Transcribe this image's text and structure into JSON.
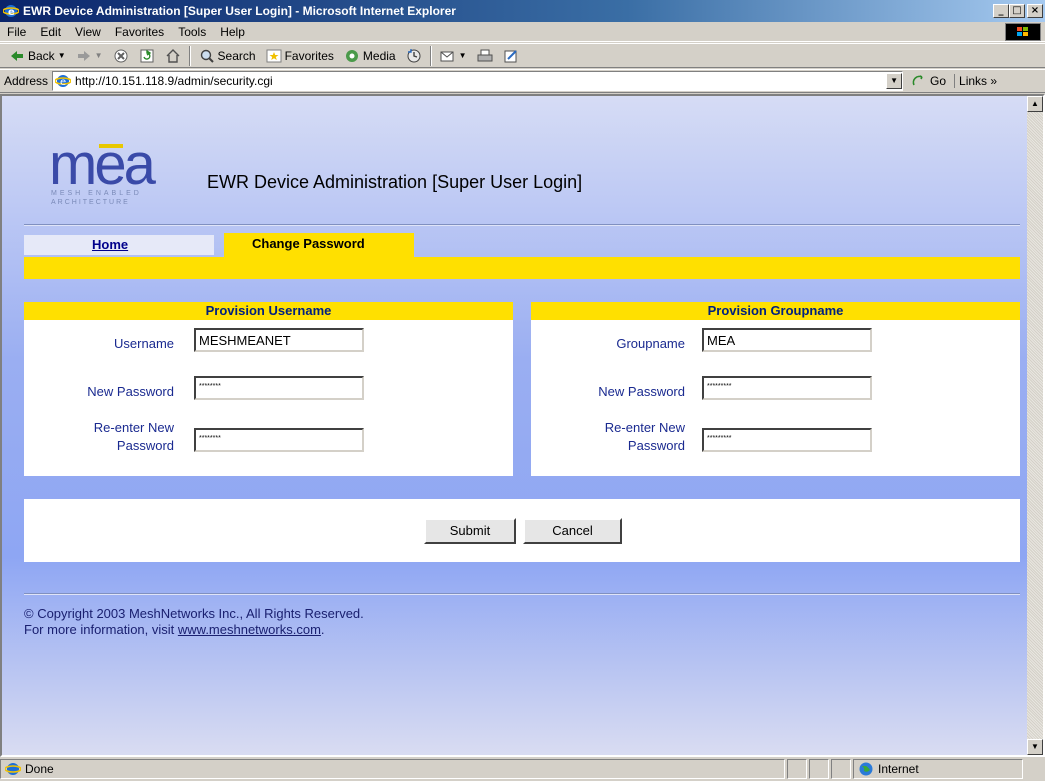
{
  "window": {
    "title": "EWR Device Administration [Super User Login] - Microsoft Internet Explorer",
    "minimize": "_",
    "maximize": "□",
    "close": "×"
  },
  "menu": [
    "File",
    "Edit",
    "View",
    "Favorites",
    "Tools",
    "Help"
  ],
  "toolbar": {
    "back": "Back",
    "search": "Search",
    "favorites": "Favorites",
    "media": "Media"
  },
  "address": {
    "label": "Address",
    "url": "http://10.151.118.9/admin/security.cgi",
    "go": "Go",
    "links": "Links"
  },
  "header": {
    "logo_text": "mea",
    "logo_sub1": "MESH ENABLED",
    "logo_sub2": "ARCHITECTURE",
    "title": "EWR Device Administration [Super User Login]"
  },
  "tabs": [
    {
      "label": "Home",
      "active": false
    },
    {
      "label": "Change Password",
      "active": true
    }
  ],
  "panels": {
    "username": {
      "heading": "Provision Username",
      "name_label": "Username",
      "name_value": "MESHMEANET",
      "new_pw_label": "New Password",
      "new_pw_value": "********",
      "reenter_label_1": "Re-enter New",
      "reenter_label_2": "Password",
      "reenter_value": "********"
    },
    "groupname": {
      "heading": "Provision Groupname",
      "name_label": "Groupname",
      "name_value": "MEA",
      "new_pw_label": "New Password",
      "new_pw_value": "*********",
      "reenter_label_1": "Re-enter New",
      "reenter_label_2": "Password",
      "reenter_value": "*********"
    }
  },
  "actions": {
    "submit": "Submit",
    "cancel": "Cancel"
  },
  "footer": {
    "copyright": "© Copyright 2003 MeshNetworks Inc., All Rights Reserved.",
    "info_prefix": "For more information, visit ",
    "link": "www.meshnetworks.com",
    "info_suffix": "."
  },
  "status": {
    "text": "Done",
    "zone": "Internet"
  },
  "colors": {
    "accent_yellow": "#ffe000",
    "panel_heading_text": "#002080",
    "title_bar": "#0a246a"
  }
}
